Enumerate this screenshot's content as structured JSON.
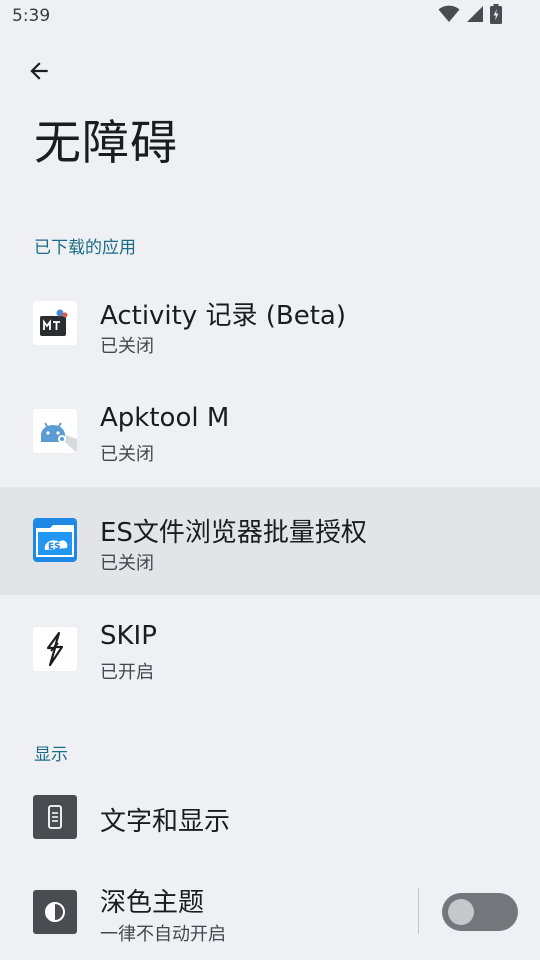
{
  "status_bar": {
    "time": "5:39",
    "icons": [
      "wifi-icon",
      "cellular-signal-icon",
      "battery-charging-icon"
    ]
  },
  "header": {
    "back_icon": "arrow-back-icon",
    "title": "无障碍"
  },
  "sections": {
    "downloaded_apps": {
      "header": "已下载的应用",
      "items": [
        {
          "title": "Activity 记录 (Beta)",
          "subtitle": "已关闭",
          "icon": "mt-manager-app-icon"
        },
        {
          "title": "Apktool M",
          "subtitle": "已关闭",
          "icon": "android-robot-app-icon"
        },
        {
          "title": "ES文件浏览器批量授权",
          "subtitle": "已关闭",
          "icon": "es-file-explorer-app-icon"
        },
        {
          "title": "SKIP",
          "subtitle": "已开启",
          "icon": "skip-lightning-app-icon"
        }
      ]
    },
    "display": {
      "header": "显示",
      "items": [
        {
          "title": "文字和显示",
          "icon": "text-display-icon"
        },
        {
          "title": "深色主题",
          "subtitle": "一律不自动开启",
          "icon": "dark-theme-icon",
          "toggle_on": false
        }
      ]
    }
  },
  "colors": {
    "background": "#eff0f4",
    "accent": "#1a6d84",
    "highlight_row": "#e3e4e8",
    "toggle_off_track": "#74767b"
  }
}
